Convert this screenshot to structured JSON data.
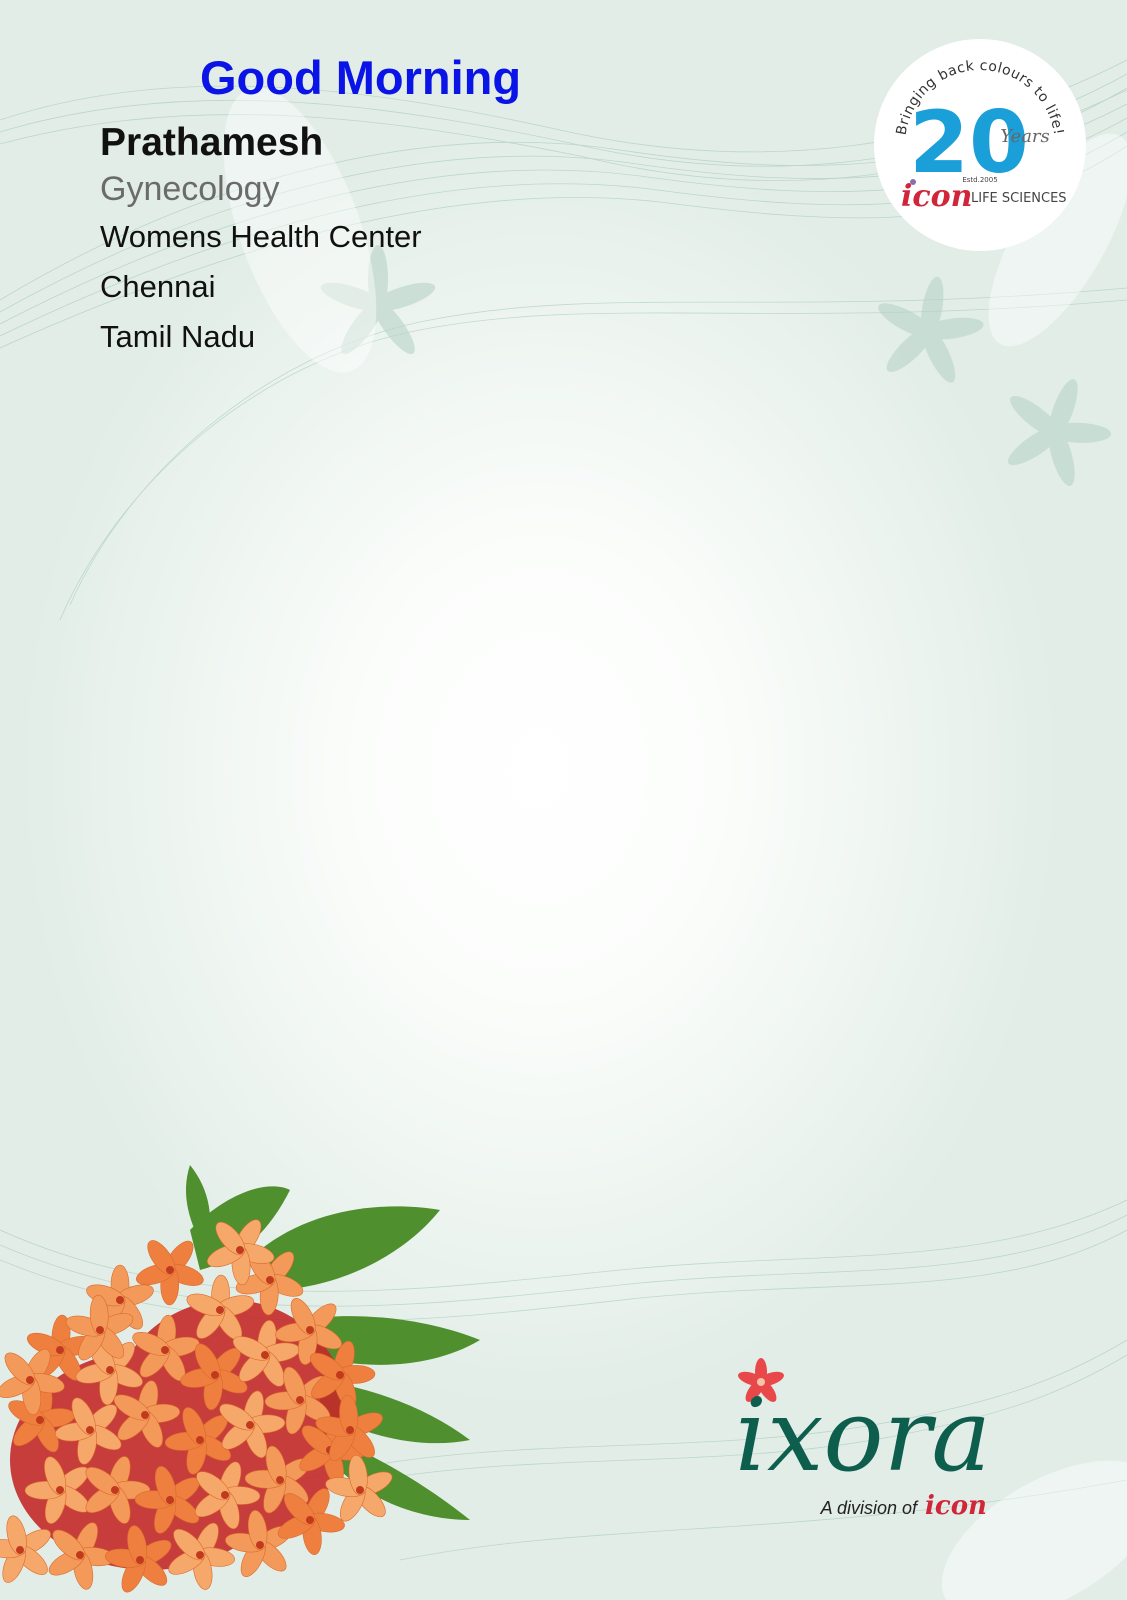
{
  "greeting": "Good Morning",
  "doctor": {
    "name": "Prathamesh",
    "specialty": "Gynecology",
    "clinic": "Womens Health Center",
    "city": "Chennai",
    "state": "Tamil Nadu"
  },
  "seal": {
    "tagline": "Bringing back colours to life!",
    "number": "20",
    "years": "Years",
    "established": "Estd.2005",
    "brand": "icon",
    "brand_suffix": "LIFE SCIENCES"
  },
  "ixora_logo": {
    "name": "ixora",
    "division_text": "A division of",
    "division_brand": "icon"
  },
  "colors": {
    "greeting": "#0a14e6",
    "brand_green": "#0e5e4e",
    "brand_red": "#d1263a",
    "seal_blue": "#1b9fd8"
  },
  "icons": [
    "flower-bouquet-icon",
    "leaf-sparkle-icon",
    "star-flower-icon"
  ]
}
